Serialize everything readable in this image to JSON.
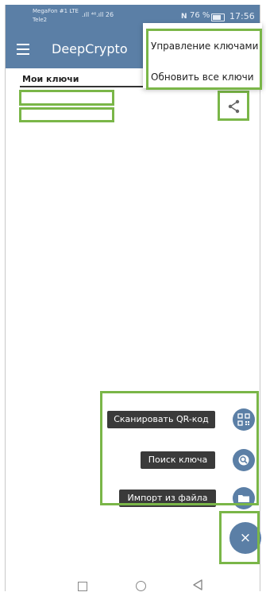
{
  "status_bar": {
    "carrier_line1": "MegaFon #1 LTE",
    "carrier_line2": "Tele2",
    "signal": ".ıll ⁴⁶.ıll 26",
    "nfc": "N",
    "battery_percent": "76 %",
    "time": "17:56"
  },
  "app_bar": {
    "title": "DeepCrypto"
  },
  "overflow_menu": {
    "items": [
      "Управление ключами",
      "Обновить все ключи"
    ]
  },
  "tab": {
    "label": "Мои ключи"
  },
  "fab_menu": {
    "options": [
      "Сканировать QR-код",
      "Поиск ключа",
      "Импорт из файла"
    ],
    "close_label": "×"
  },
  "colors": {
    "primary": "#5b7fa6",
    "highlight": "#7ab648",
    "label_bg": "#3a3a3a"
  },
  "icons": {
    "menu": "hamburger-menu-icon",
    "share": "share-icon",
    "qr": "qr-code-icon",
    "search": "search-icon",
    "folder": "folder-icon",
    "close": "close-icon"
  }
}
